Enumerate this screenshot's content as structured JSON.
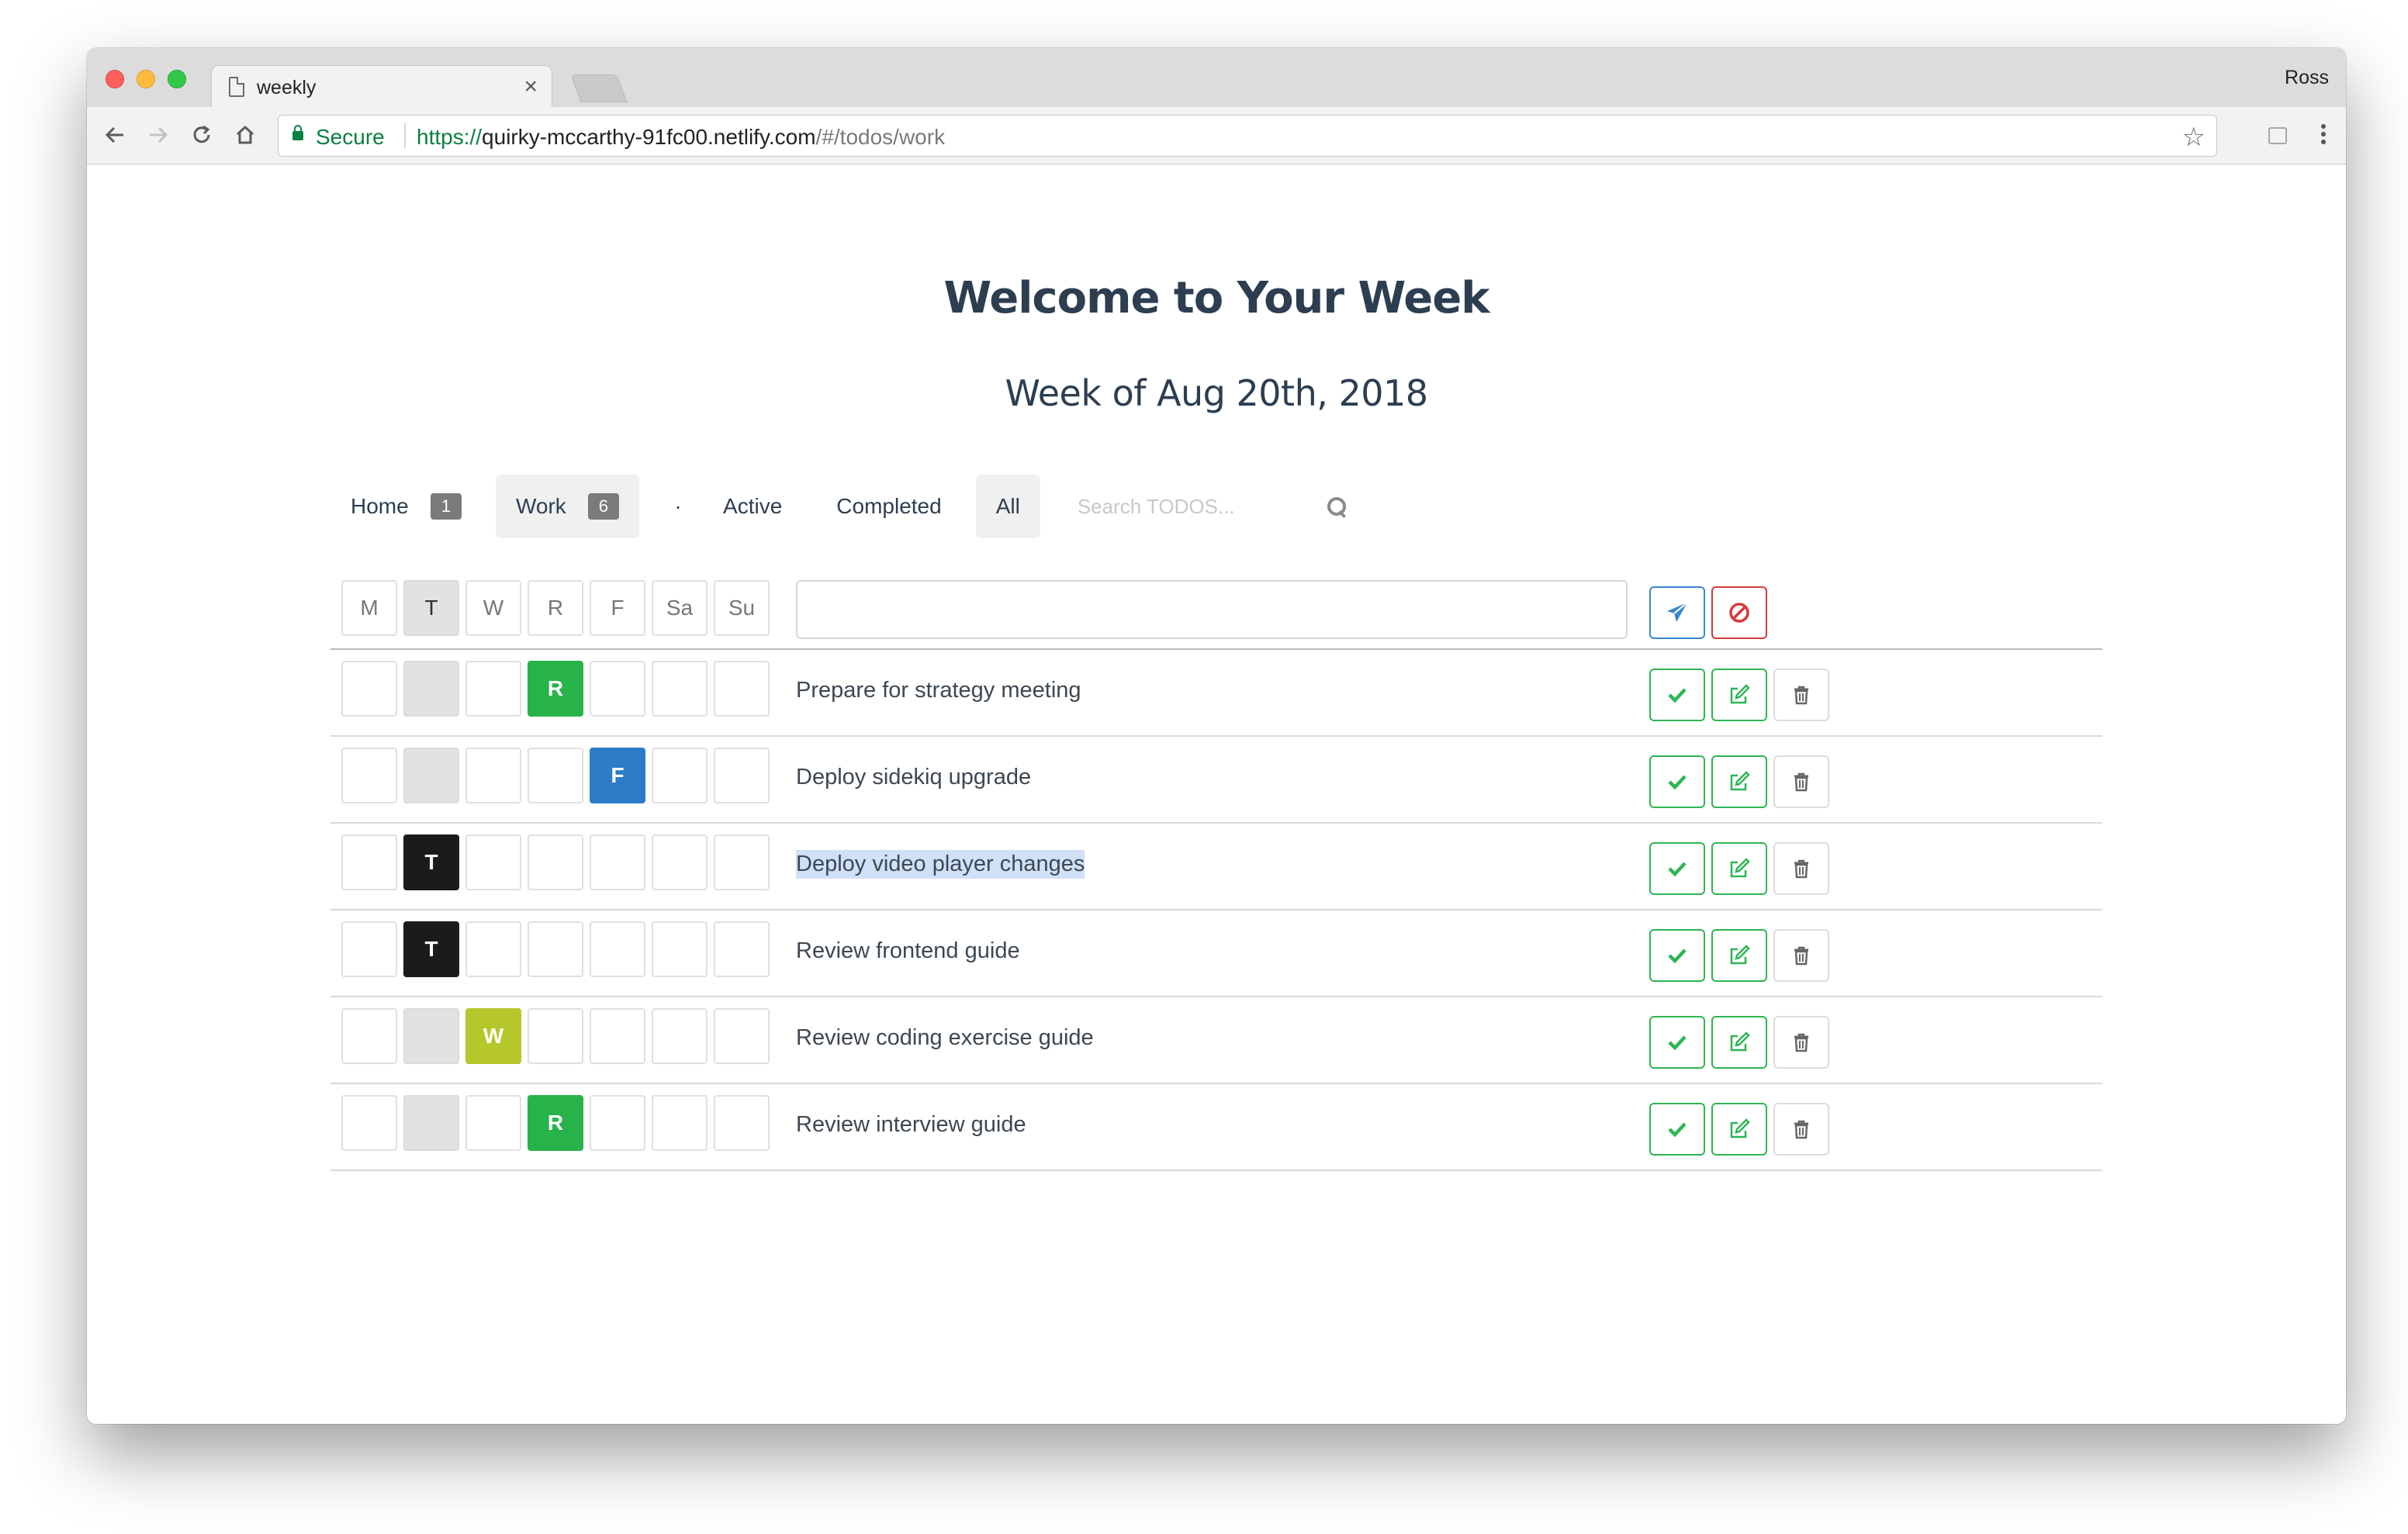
{
  "browser": {
    "tab_title": "weekly",
    "tab_close": "×",
    "user": "Ross",
    "secure_label": "Secure",
    "url_scheme": "https://",
    "url_host": "quirky-mccarthy-91fc00.netlify.com",
    "url_path": "/#/todos/work"
  },
  "page": {
    "title": "Welcome to Your Week",
    "subtitle": "Week of Aug 20th, 2018"
  },
  "filters": {
    "lists": [
      {
        "label": "Home",
        "count": "1",
        "selected": false
      },
      {
        "label": "Work",
        "count": "6",
        "selected": true
      }
    ],
    "separator": "·",
    "status": [
      {
        "label": "Active",
        "selected": false
      },
      {
        "label": "Completed",
        "selected": false
      },
      {
        "label": "All",
        "selected": true
      }
    ],
    "search_placeholder": "Search TODOS..."
  },
  "day_headers": [
    "M",
    "T",
    "W",
    "R",
    "F",
    "Sa",
    "Su"
  ],
  "today_index": 1,
  "new_todo_value": "",
  "todos": [
    {
      "text": "Prepare for strategy meeting",
      "day_index": 3,
      "day_letter": "R",
      "color": "#27b34a",
      "highlighted": false
    },
    {
      "text": "Deploy sidekiq upgrade",
      "day_index": 4,
      "day_letter": "F",
      "color": "#2c7cc8",
      "highlighted": false
    },
    {
      "text": "Deploy video player changes",
      "day_index": 1,
      "day_letter": "T",
      "color": "#1b1b1b",
      "highlighted": true
    },
    {
      "text": "Review frontend guide",
      "day_index": 1,
      "day_letter": "T",
      "color": "#1b1b1b",
      "highlighted": false
    },
    {
      "text": "Review coding exercise guide",
      "day_index": 2,
      "day_letter": "W",
      "color": "#b6c72b",
      "highlighted": false
    },
    {
      "text": "Review interview guide",
      "day_index": 3,
      "day_letter": "R",
      "color": "#27b34a",
      "highlighted": false
    }
  ],
  "icons": {
    "submit": "paper-plane-icon",
    "cancel": "ban-icon",
    "complete": "check-icon",
    "edit": "edit-icon",
    "delete": "trash-icon"
  },
  "colors": {
    "heading": "#2c3e50",
    "submit": "#3a88cf",
    "cancel": "#d63a3a",
    "complete": "#2db653"
  }
}
